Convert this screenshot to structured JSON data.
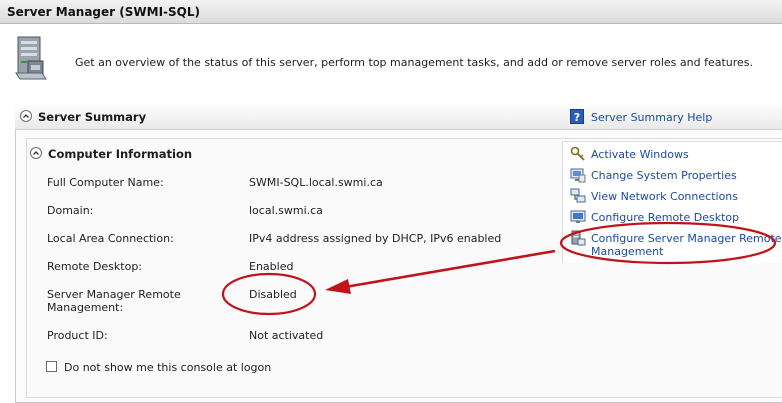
{
  "window": {
    "title": "Server Manager (SWMI-SQL)"
  },
  "intro": {
    "text": "Get an overview of the status of this server, perform top management tasks, and add or remove server roles and features.",
    "icon": "server-manager-icon"
  },
  "summary": {
    "title": "Server Summary",
    "help_label": "Server Summary Help",
    "section_title": "Computer Information",
    "rows": [
      {
        "label": "Full Computer Name:",
        "value": "SWMI-SQL.local.swmi.ca"
      },
      {
        "label": "Domain:",
        "value": "local.swmi.ca"
      },
      {
        "label": "Local Area Connection:",
        "value": "IPv4 address assigned by DHCP, IPv6 enabled"
      },
      {
        "label": "Remote Desktop:",
        "value": "Enabled"
      },
      {
        "label_line1": "Server Manager Remote",
        "label_line2": "Management:",
        "value": "Disabled"
      },
      {
        "label": "Product ID:",
        "value": "Not activated"
      }
    ],
    "tasks": [
      {
        "label": "Activate Windows",
        "icon": "key-icon"
      },
      {
        "label": "Change System Properties",
        "icon": "system-properties-icon"
      },
      {
        "label": "View Network Connections",
        "icon": "network-icon"
      },
      {
        "label": "Configure Remote Desktop",
        "icon": "remote-desktop-icon"
      },
      {
        "label_line1": "Configure Server Manager Remote",
        "label_line2": "Management",
        "icon": "server-remote-icon"
      }
    ],
    "checkbox_label": "Do not show me this console at logon",
    "checkbox_checked": false
  },
  "annotation": {
    "color": "#c0141b"
  }
}
